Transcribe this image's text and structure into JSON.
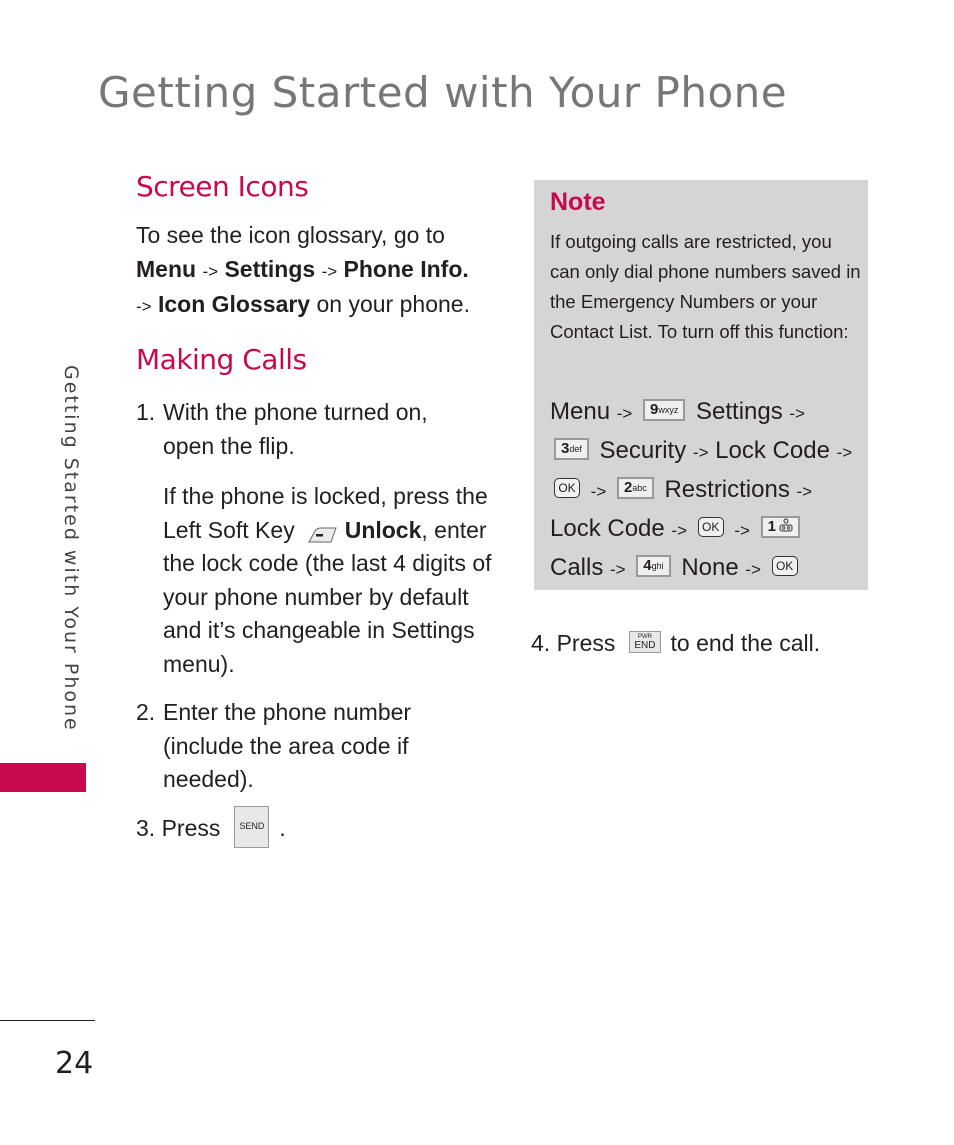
{
  "page": {
    "title": "Getting Started with Your Phone",
    "side_tab": "Getting Started with Your Phone",
    "page_number": "24",
    "accent_color": "#c8094d"
  },
  "screen_icons": {
    "heading": "Screen Icons",
    "intro": "To see the icon glossary, go to",
    "path": {
      "menu": "Menu",
      "arrow": "->",
      "settings": "Settings",
      "phone_info": "Phone Info.",
      "icon_glossary": "Icon Glossary",
      "suffix": "on your phone."
    }
  },
  "making_calls": {
    "heading": "Making Calls",
    "step1": {
      "num": "1.",
      "text": "With the phone turned on, open the flip."
    },
    "step1_detail": {
      "before": "If the phone is locked, press the Left Soft Key",
      "soft_key_icon": "left-soft-key-icon",
      "bold": "Unlock",
      "after": ", enter the lock code (the last 4 digits of your phone number by default and it’s changeable in Settings menu)."
    },
    "step2": {
      "num": "2.",
      "text": "Enter the phone number (include the area code if needed)."
    },
    "step3": {
      "num": "3.",
      "text": "Press",
      "key": "SEND",
      "suffix": "."
    },
    "step4": {
      "num": "4.",
      "text": "Press",
      "key_top": "PWR",
      "key_main": "END",
      "suffix": "to end the call."
    }
  },
  "note": {
    "title": "Note",
    "text": "If outgoing calls are restricted, you can only dial phone numbers saved in the Emergency Numbers or your Contact List. To turn off this function:",
    "path": {
      "menu": "Menu",
      "arrow": "->",
      "key9": "9",
      "key9_sub": "wxyz",
      "settings": "Settings",
      "key3": "3",
      "key3_sub": "def",
      "security": "Security",
      "lock_code": "Lock Code",
      "ok": "OK",
      "key2": "2",
      "key2_sub": "abc",
      "restrictions": "Restrictions",
      "key1": "1",
      "key1_sub": "voicemail-icon",
      "calls": "Calls",
      "key4": "4",
      "key4_sub": "ghi",
      "none": "None"
    }
  }
}
